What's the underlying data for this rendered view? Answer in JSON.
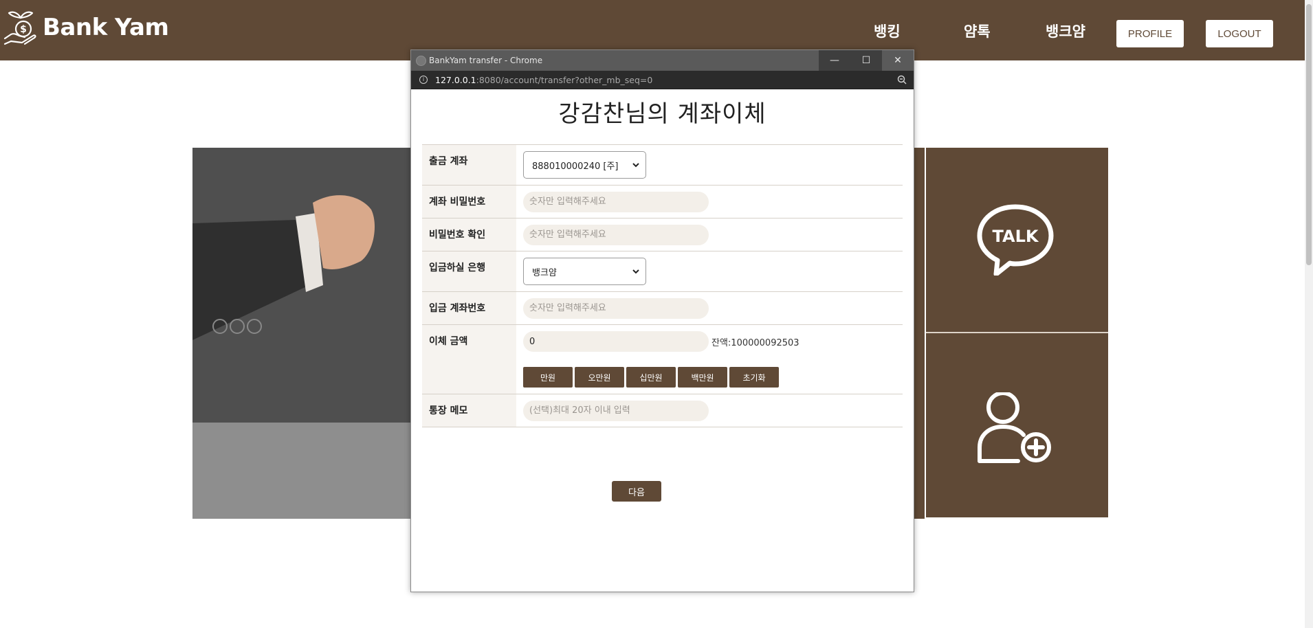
{
  "site": {
    "brand": "Bank Yam",
    "nav": [
      "뱅킹",
      "얌톡",
      "뱅크얌"
    ],
    "profile_label": "PROFILE",
    "logout_label": "LOGOUT",
    "colors": {
      "brand": "#5f4936",
      "header_text": "#ffffff"
    },
    "tiles": [
      {
        "icon": "talk-bubble-icon"
      },
      {
        "icon": "add-user-icon"
      }
    ]
  },
  "popup": {
    "window_title": "BankYam transfer - Chrome",
    "url_host": "127.0.0.1",
    "url_rest": ":8080/account/transfer?other_mb_seq=0",
    "controls": {
      "minimize": "—",
      "maximize": "☐",
      "close": "✕"
    },
    "form": {
      "title": "강감찬님의 계좌이체",
      "rows": {
        "from_account": {
          "label": "출금 계좌",
          "value": "888010000240 [주]"
        },
        "password": {
          "label": "계좌 비밀번호",
          "placeholder": "숫자만 입력해주세요"
        },
        "password_confirm": {
          "label": "비밀번호 확인",
          "placeholder": "숫자만 입력해주세요"
        },
        "bank": {
          "label": "입금하실 은행",
          "value": "뱅크얌"
        },
        "to_account": {
          "label": "입금 계좌번호",
          "placeholder": "숫자만 입력해주세요"
        },
        "amount": {
          "label": "이체 금액",
          "value": "0",
          "balance": "잔액:100000092503",
          "buttons": [
            "만원",
            "오만원",
            "십만원",
            "백만원",
            "초기화"
          ]
        },
        "memo": {
          "label": "통장 메모",
          "placeholder": "(선택)최대 20자 이내 입력"
        }
      },
      "next_label": "다음"
    }
  }
}
